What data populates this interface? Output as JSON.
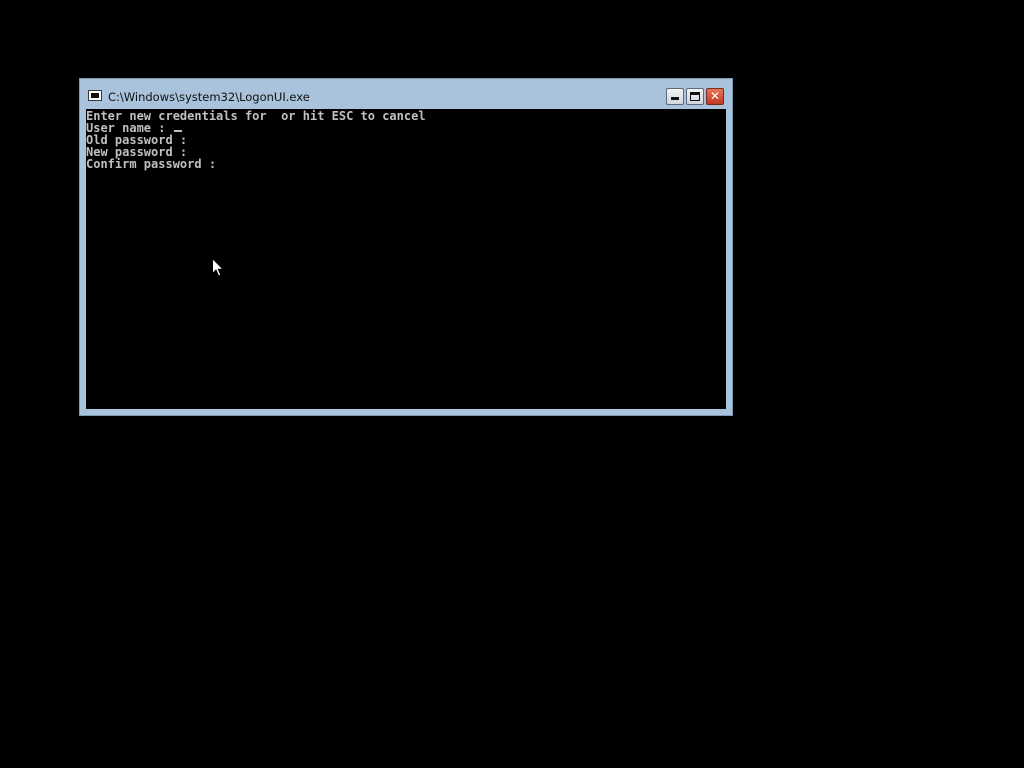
{
  "window": {
    "title": "C:\\Windows\\system32\\LogonUI.exe",
    "icon": "console-window-icon",
    "buttons": {
      "minimize": "minimize-icon",
      "maximize": "maximize-icon",
      "close": "close-icon"
    },
    "close_glyph": "✕"
  },
  "console": {
    "lines": [
      "Enter new credentials for  or hit ESC to cancel",
      "User name : ",
      "Old password :",
      "New password :",
      "Confirm password :"
    ]
  },
  "colors": {
    "desktop_background": "#000000",
    "window_frame": "#a9c3dc",
    "console_background": "#000000",
    "console_text": "#c0c0c0",
    "close_button": "#c0391f"
  },
  "pointer": "mouse-pointer-icon"
}
